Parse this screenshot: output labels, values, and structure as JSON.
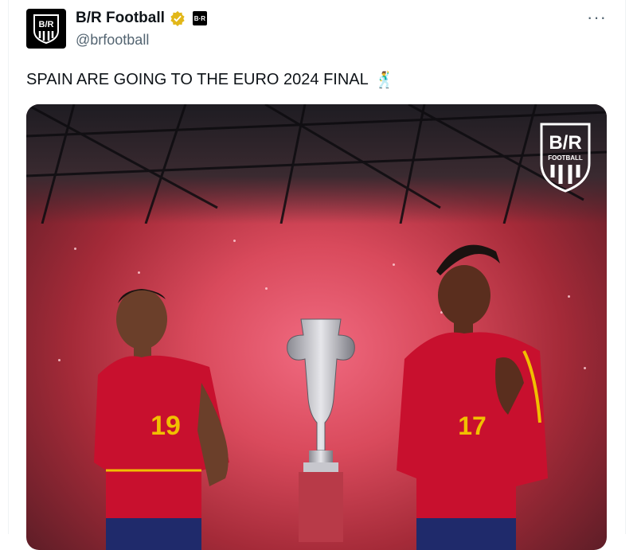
{
  "tweet": {
    "display_name": "B/R Football",
    "handle": "@brfootball",
    "text": "SPAIN ARE GOING TO THE EURO 2024 FINAL",
    "emoji": "🕺",
    "affiliate_badge": "B·R",
    "more_label": "···"
  },
  "media": {
    "logo_text": "B/R",
    "logo_sub": "FOOTBALL",
    "player_left_number": "19",
    "player_right_number": "17"
  },
  "colors": {
    "verified_gold": "#e2b719",
    "kit_red": "#c8102e",
    "kit_gold": "#f1bf00",
    "shorts_navy": "#1f2a6b"
  }
}
